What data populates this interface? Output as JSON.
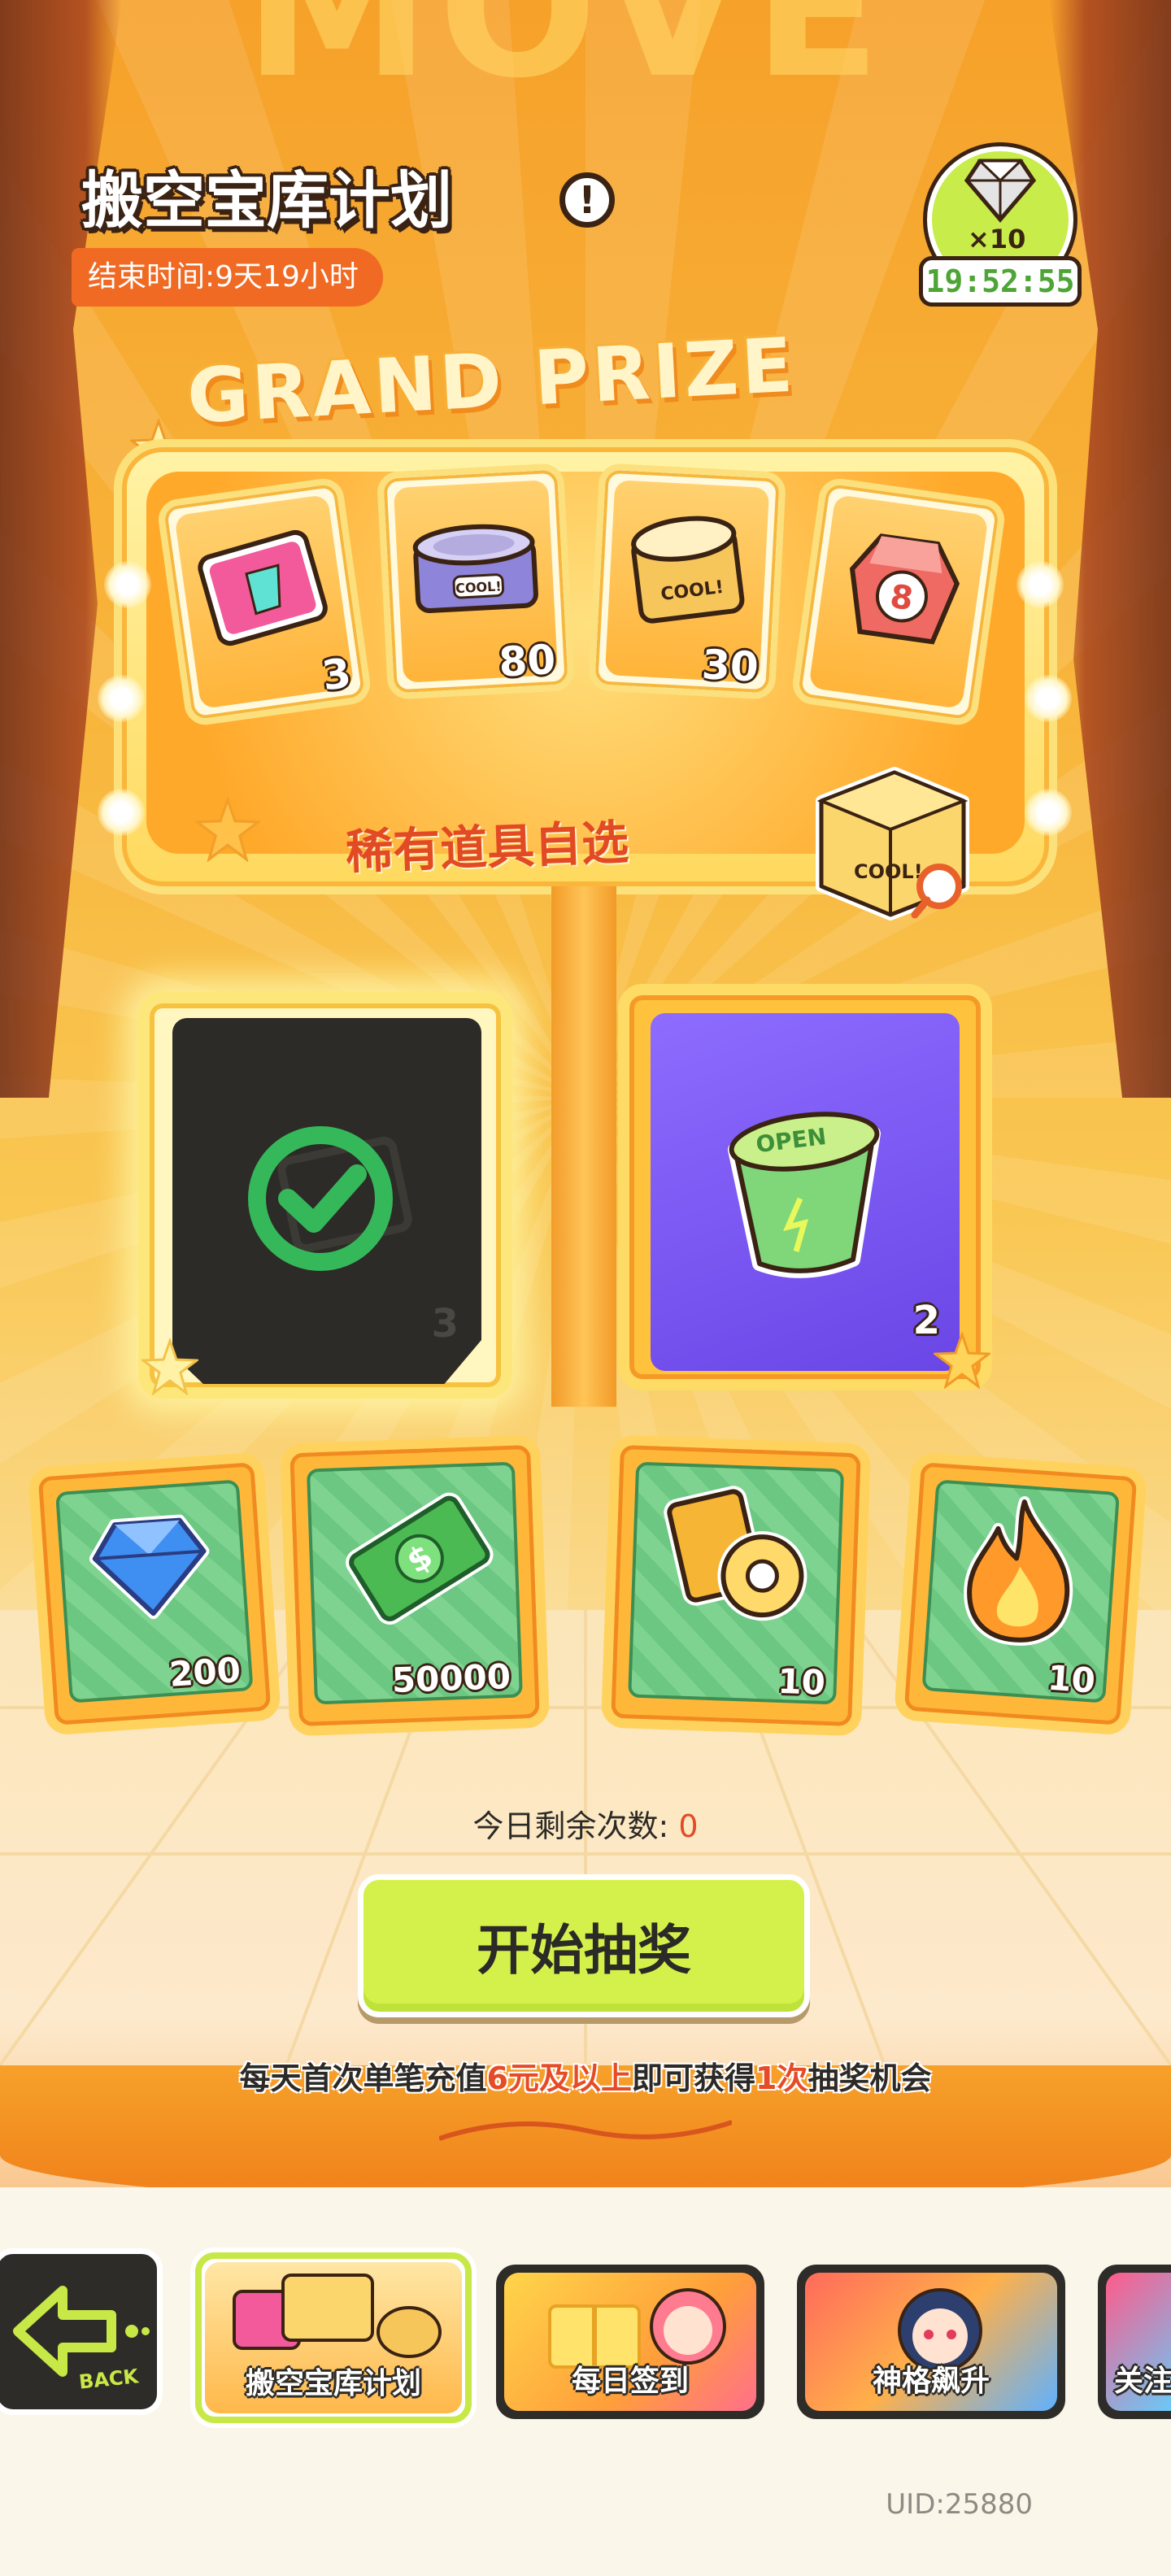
{
  "header": {
    "title": "搬空宝库计划",
    "end_time": "结束时间:9天19小时",
    "info_icon": "exclamation-icon",
    "gem_badge": {
      "multiplier": "×10",
      "timer": "19:52:55"
    }
  },
  "grand_prize": {
    "title": "GRAND PRIZE",
    "items": [
      {
        "icon": "card-pack-icon",
        "count": "3"
      },
      {
        "icon": "purple-can-icon",
        "count": "80"
      },
      {
        "icon": "orange-can-icon",
        "count": "30"
      },
      {
        "icon": "red-dice-icon",
        "count": ""
      }
    ],
    "rare_label": "稀有道具自选",
    "rare_box_icon": "mystery-box-icon"
  },
  "feature_cards": [
    {
      "state": "claimed",
      "icon": "check-icon",
      "count": "3"
    },
    {
      "state": "available",
      "icon": "jelly-cup-icon",
      "count": "2"
    }
  ],
  "reward_cards": [
    {
      "icon": "diamond-icon",
      "count": "200"
    },
    {
      "icon": "cash-icon",
      "count": "50000"
    },
    {
      "icon": "ticket-roll-icon",
      "count": "10"
    },
    {
      "icon": "flame-icon",
      "count": "10"
    }
  ],
  "draw": {
    "remaining_label": "今日剩余次数:",
    "remaining_value": "0",
    "button_label": "开始抽奖",
    "rule_parts": [
      "每天首次单笔充值",
      "6元及以上",
      "即可获得",
      "1次",
      "抽奖机会"
    ]
  },
  "nav": {
    "back_label": "BACK",
    "tabs": [
      {
        "label": "搬空宝库计划",
        "selected": true
      },
      {
        "label": "每日签到",
        "selected": false
      },
      {
        "label": "神格飙升",
        "selected": false
      },
      {
        "label": "关注",
        "selected": false
      }
    ]
  },
  "uid": "UID:25880"
}
